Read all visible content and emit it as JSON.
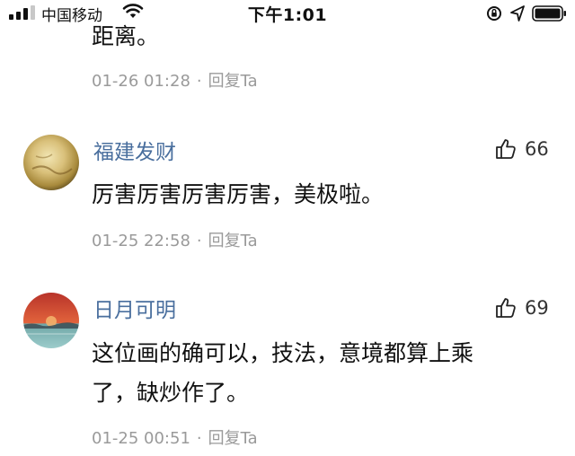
{
  "status_bar": {
    "carrier": "中国移动",
    "time": "下午1:01"
  },
  "comments": [
    {
      "text_tail": "距离。",
      "date": "01-26 01:28",
      "separator": "·",
      "reply_label": "回复Ta"
    },
    {
      "username": "福建发财",
      "likes": "66",
      "text": "厉害厉害厉害厉害，美极啦。",
      "date": "01-25 22:58",
      "separator": "·",
      "reply_label": "回复Ta"
    },
    {
      "username": "日月可明",
      "likes": "69",
      "text_line1": "这位画的确可以，技法，意境都算上乘",
      "text_line2": "了，缺炒作了。",
      "date": "01-25 00:51",
      "separator": "·",
      "reply_label": "回复Ta"
    }
  ]
}
